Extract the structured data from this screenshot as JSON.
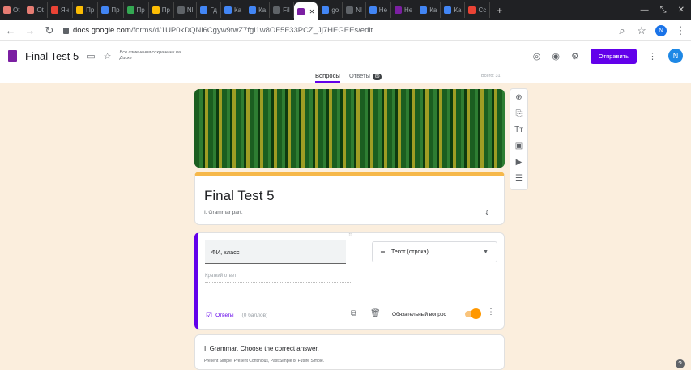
{
  "browser": {
    "tabs": [
      "Ot",
      "Ot",
      "Ян",
      "Пр",
      "Пр",
      "Пр",
      "Пр",
      "Nl",
      "Гд",
      "Ка",
      "Ка",
      "Fil",
      "",
      "go",
      "Nl",
      "He",
      "He",
      "Ка",
      "Ка",
      "Cc"
    ],
    "tab_colors": [
      "#e67c73",
      "#e67c73",
      "#ea4335",
      "#fbbc04",
      "#4285f4",
      "#34a853",
      "#fbbc04",
      "#5f6368",
      "#4285f4",
      "#4285f4",
      "#4285f4",
      "#5f6368",
      "#7b1fa2",
      "#4285f4",
      "#5f6368",
      "#4285f4",
      "#7b1fa2",
      "#4285f4",
      "#4285f4",
      "#ea4335"
    ],
    "active_tab_index": 12,
    "new_tab": "+",
    "url_host": "docs.google.com",
    "url_path": "/forms/d/1UP0kDQNl6Cgyw9twZ7fgl1w8OF5F33PCZ_Jj7HEGEEs/edit",
    "profile_initial": "N"
  },
  "form_header": {
    "title": "Final Test 5",
    "saved_status": "Все изменения сохранены на Диске",
    "send_label": "Отправить",
    "avatar_initial": "N"
  },
  "subtabs": {
    "questions": "Вопросы",
    "answers": "Ответы",
    "answers_count": "69",
    "total": "Всего: 31"
  },
  "title_card": {
    "title": "Final Test 5",
    "description": "I. Grammar part."
  },
  "question_card": {
    "question": "ФИ, класс",
    "type_label": "Текст (строка)",
    "short_answer": "Краткий ответ",
    "answers_label": "Ответы",
    "points": "(0 баллов)",
    "required_label": "Обязательный вопрос",
    "required": true
  },
  "section_card": {
    "title": "I. Grammar. Choose the correct answer.",
    "subtitle": "Present Simple,  Present Continious, Past Simple or Future Simple."
  },
  "side_tools": [
    "add-question-icon",
    "import-questions-icon",
    "title-text-icon",
    "image-icon",
    "video-icon",
    "section-icon"
  ],
  "side_tool_glyphs": [
    "⊕",
    "⎘",
    "Tт",
    "▣",
    "▶",
    "☰"
  ],
  "help": "?"
}
